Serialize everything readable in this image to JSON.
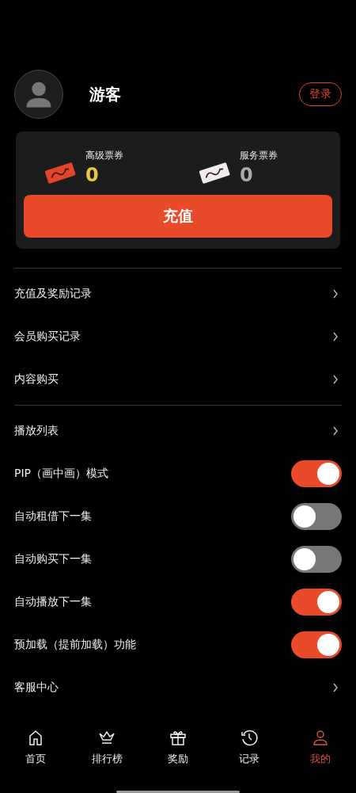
{
  "profile": {
    "name": "游客",
    "login_button": "登录"
  },
  "wallet": {
    "tickets": [
      {
        "kind": "premium",
        "label": "高级票券",
        "count": "0"
      },
      {
        "kind": "service",
        "label": "服务票券",
        "count": "0"
      }
    ],
    "recharge_button": "充值"
  },
  "sections": [
    {
      "items": [
        {
          "kind": "link",
          "label": "充值及奖励记录"
        },
        {
          "kind": "link",
          "label": "会员购买记录"
        },
        {
          "kind": "link",
          "label": "内容购买"
        }
      ]
    },
    {
      "items": [
        {
          "kind": "link",
          "label": "播放列表"
        },
        {
          "kind": "toggle",
          "label": "PIP（画中画）模式",
          "on": true
        },
        {
          "kind": "toggle",
          "label": "自动租借下一集",
          "on": false
        },
        {
          "kind": "toggle",
          "label": "自动购买下一集",
          "on": false
        },
        {
          "kind": "toggle",
          "label": "自动播放下一集",
          "on": true
        },
        {
          "kind": "toggle",
          "label": "预加载（提前加载）功能",
          "on": true
        },
        {
          "kind": "link",
          "label": "客服中心"
        }
      ]
    }
  ],
  "tab_bar": [
    {
      "kind": "home",
      "label": "首页",
      "selected": false
    },
    {
      "kind": "ranking",
      "label": "排行榜",
      "selected": false
    },
    {
      "kind": "rewards",
      "label": "奖励",
      "selected": false
    },
    {
      "kind": "history",
      "label": "记录",
      "selected": false
    },
    {
      "kind": "profile",
      "label": "我的",
      "selected": true
    }
  ]
}
